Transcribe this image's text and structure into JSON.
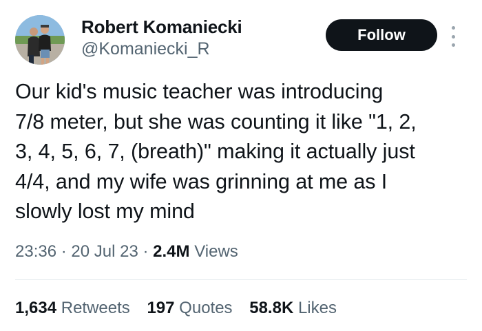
{
  "author": {
    "display_name": "Robert Komaniecki",
    "handle": "@Komaniecki_R"
  },
  "follow_label": "Follow",
  "tweet": {
    "text": "Our kid's music teacher was introducing\n7/8 meter, but she was counting it like \"1, 2,\n3, 4, 5, 6, 7, (breath)\" making it actually just\n4/4, and my wife was grinning at me as I\nslowly lost my mind"
  },
  "meta": {
    "time": "23:36",
    "separator": "·",
    "date": "20 Jul 23",
    "views_count": "2.4M",
    "views_label": "Views"
  },
  "stats": {
    "retweets_count": "1,634",
    "retweets_label": "Retweets",
    "quotes_count": "197",
    "quotes_label": "Quotes",
    "likes_count": "58.8K",
    "likes_label": "Likes"
  },
  "icons": {
    "more": "more-vertical-icon"
  },
  "colors": {
    "text": "#0f1419",
    "secondary": "#536471",
    "button_bg": "#0f1419",
    "button_text": "#ffffff",
    "divider": "#e6ebee"
  }
}
